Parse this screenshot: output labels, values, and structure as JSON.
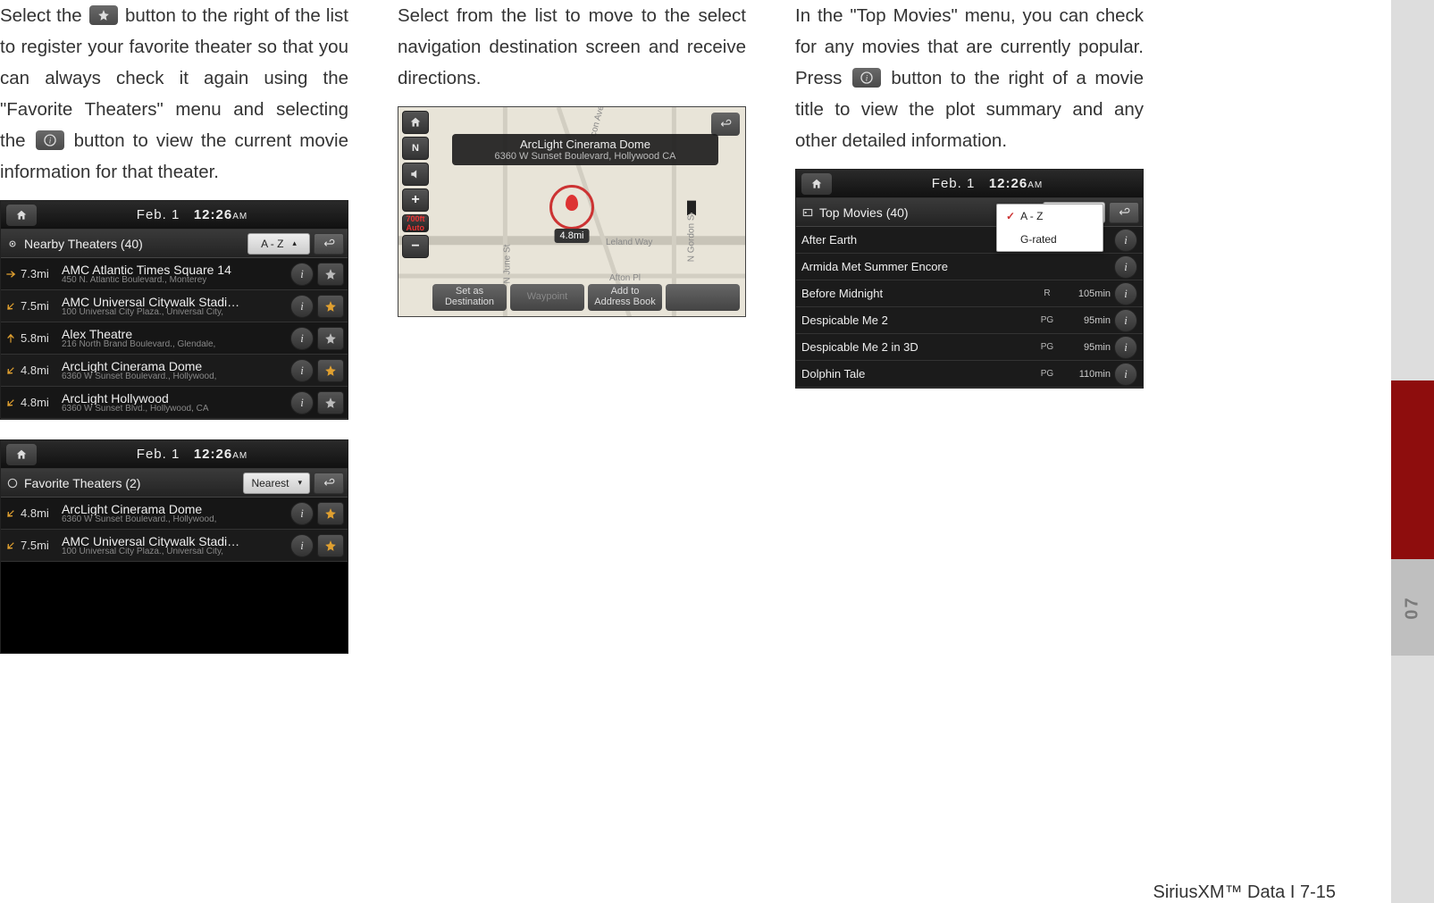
{
  "col1": {
    "text_a": "Select the ",
    "text_b": " button to the right of the list to register your favorite theater so that you can always check it again using the \"Favorite Theaters\" menu and selecting the ",
    "text_c": " button to view the current movie information for that theater."
  },
  "clock": {
    "date": "Feb.  1",
    "time": "12:26",
    "ampm": "AM"
  },
  "nearby": {
    "title": "Nearby Theaters (40)",
    "sort": "A - Z",
    "rows": [
      {
        "dist": "7.3mi",
        "dir": "right",
        "name": "AMC Atlantic Times Square 14",
        "addr": "450 N. Atlantic Boulevard., Monterey",
        "fav": false
      },
      {
        "dist": "7.5mi",
        "dir": "downleft",
        "name": "AMC Universal Citywalk Stadi…",
        "addr": "100 Universal City Plaza., Universal City,",
        "fav": true
      },
      {
        "dist": "5.8mi",
        "dir": "up",
        "name": "Alex Theatre",
        "addr": "216 North Brand Boulevard., Glendale,",
        "fav": false
      },
      {
        "dist": "4.8mi",
        "dir": "downleft",
        "name": "ArcLight Cinerama Dome",
        "addr": "6360 W Sunset Boulevard., Hollywood,",
        "fav": true
      },
      {
        "dist": "4.8mi",
        "dir": "downleft",
        "name": "ArcLight Hollywood",
        "addr": "6360 W Sunset Blvd., Hollywood, CA",
        "fav": false
      }
    ]
  },
  "favorites": {
    "title": "Favorite Theaters (2)",
    "sort": "Nearest",
    "rows": [
      {
        "dist": "4.8mi",
        "dir": "downleft",
        "name": "ArcLight Cinerama Dome",
        "addr": "6360 W Sunset Boulevard., Hollywood,",
        "fav": true
      },
      {
        "dist": "7.5mi",
        "dir": "downleft",
        "name": "AMC Universal Citywalk Stadi…",
        "addr": "100 Universal City Plaza., Universal City,",
        "fav": true
      }
    ]
  },
  "col2": {
    "text": "Select from the list to move to the select navigation destination screen and receive directions."
  },
  "map": {
    "title": "ArcLight Cinerama Dome",
    "subtitle": "6360 W Sunset Boulevard, Hollywood CA",
    "distance": "4.8mi",
    "buttons": {
      "setdest": "Set as\nDestination",
      "waypoint": "Waypoint",
      "addbook": "Add to\nAddress Book",
      "last": ""
    },
    "streets": {
      "s1": "Leland Way",
      "s2": "Afton Pl",
      "s3": "N Gordon St",
      "s4": "N June St",
      "s5": "con Ave"
    }
  },
  "col3": {
    "text_a": "In the \"Top Movies\" menu, you can check for any movies that are currently popular. Press ",
    "text_b": " button to the right of a movie title to view the plot summary and any other detailed information."
  },
  "topmovies": {
    "title": "Top Movies (40)",
    "sort": "A - Z",
    "dd": {
      "opt1": "A - Z",
      "opt2": "G-rated"
    },
    "rows": [
      {
        "title": "After Earth",
        "rating": "",
        "dur": ""
      },
      {
        "title": "Armida Met Summer Encore",
        "rating": "",
        "dur": ""
      },
      {
        "title": "Before Midnight",
        "rating": "R",
        "dur": "105min"
      },
      {
        "title": "Despicable Me 2",
        "rating": "PG",
        "dur": "95min"
      },
      {
        "title": "Despicable Me 2 in 3D",
        "rating": "PG",
        "dur": "95min"
      },
      {
        "title": "Dolphin Tale",
        "rating": "PG",
        "dur": "110min"
      }
    ]
  },
  "sidebar": {
    "label": "07"
  },
  "footer": "SiriusXM™ Data I 7-15"
}
